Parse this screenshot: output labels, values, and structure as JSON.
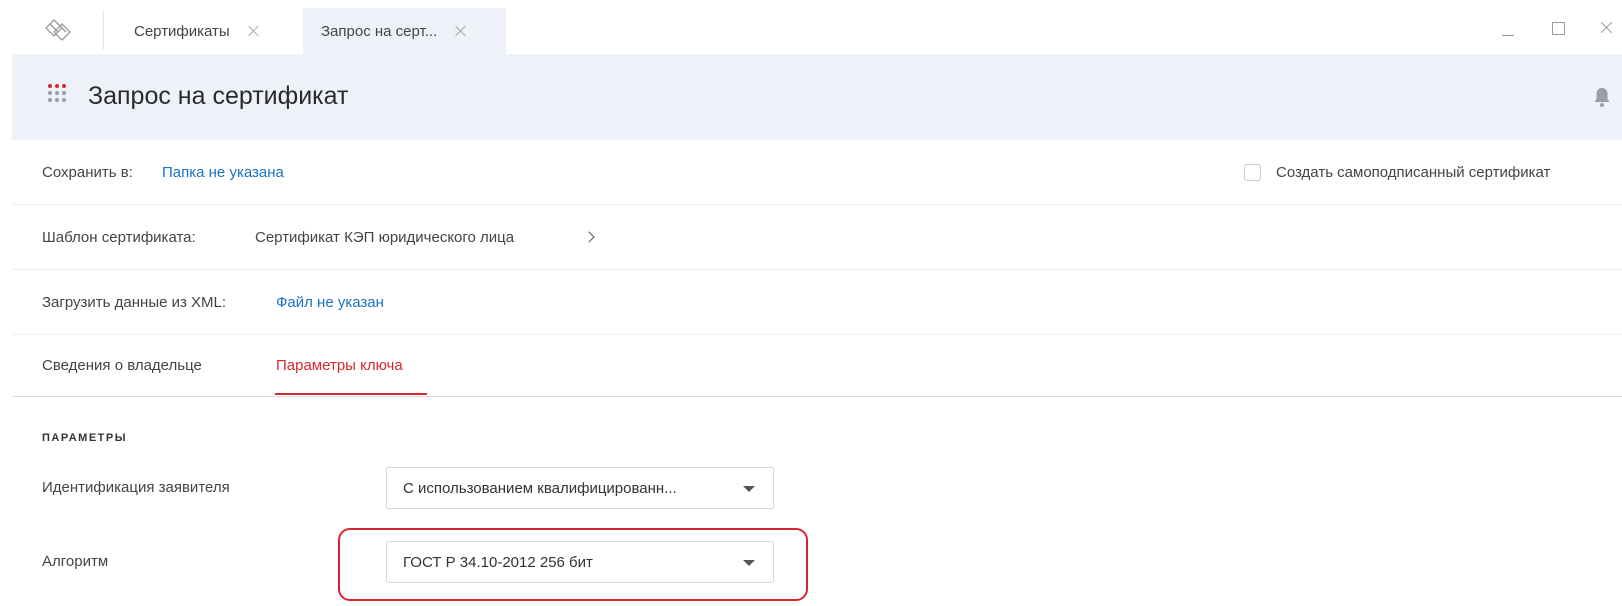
{
  "tabs": [
    {
      "label": "Сертификаты",
      "active": false
    },
    {
      "label": "Запрос на серт...",
      "active": true
    }
  ],
  "header": {
    "title": "Запрос на сертификат"
  },
  "save_row": {
    "label": "Сохранить в:",
    "value": "Папка не указана",
    "self_signed_label": "Создать самоподписанный сертификат",
    "self_signed_checked": false
  },
  "template_row": {
    "label": "Шаблон сертификата:",
    "value": "Сертификат КЭП юридического лица"
  },
  "xml_row": {
    "label": "Загрузить данные из XML:",
    "value": "Файл не указан"
  },
  "content_tabs": [
    {
      "label": "Сведения о владельце",
      "active": false
    },
    {
      "label": "Параметры ключа",
      "active": true
    }
  ],
  "params": {
    "section_title": "ПАРАМЕТРЫ",
    "identification": {
      "label": "Идентификация заявителя",
      "value": "С использованием квалифицированн..."
    },
    "algorithm": {
      "label": "Алгоритм",
      "value": "ГОСТ Р 34.10-2012 256 бит"
    }
  },
  "colors": {
    "accent": "#d9262e",
    "link": "#1a73c8",
    "header_bg": "#eef1f7"
  },
  "icons": {
    "logo": "app-logo-icon",
    "menu": "grid-menu-icon",
    "notifications": "bell-icon"
  }
}
